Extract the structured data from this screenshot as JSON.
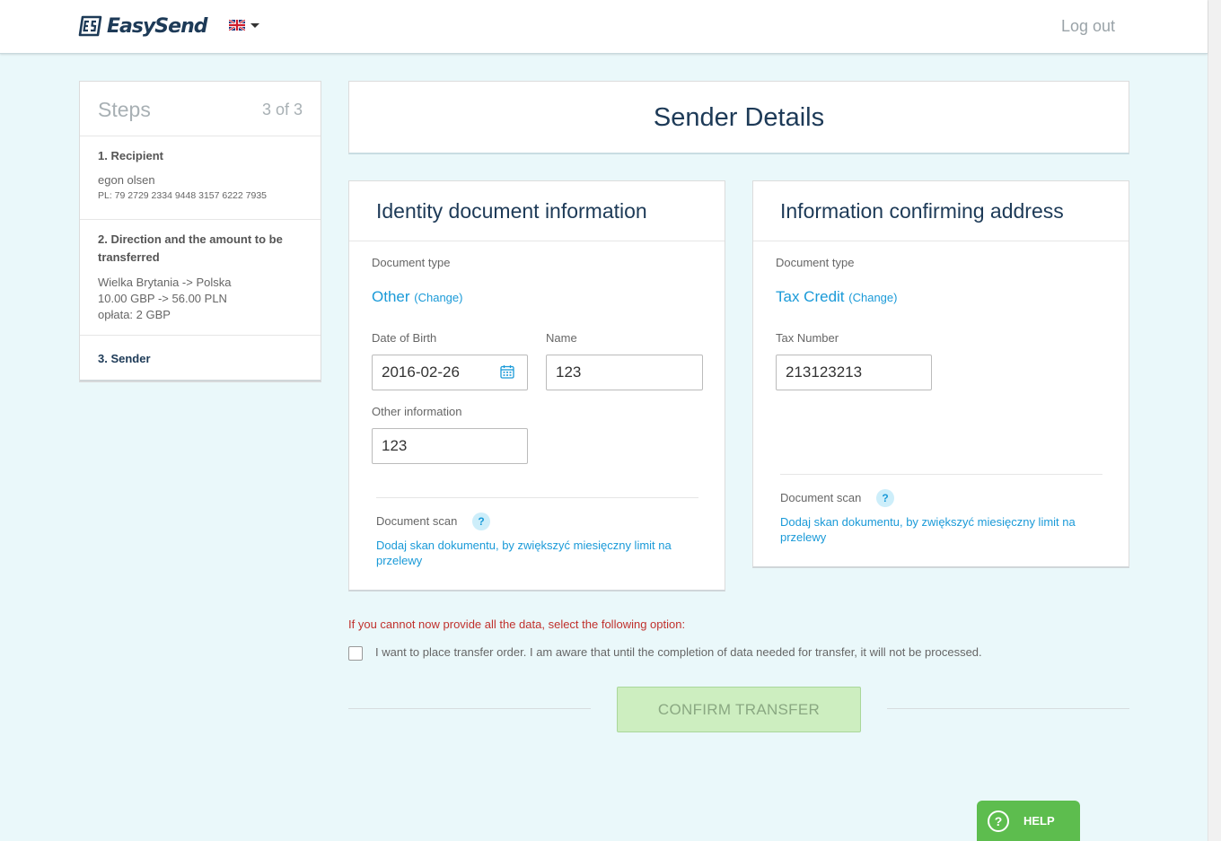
{
  "header": {
    "brand": "EasySend",
    "logout_label": "Log out"
  },
  "steps": {
    "title": "Steps",
    "count": "3 of 3",
    "step1": {
      "title": "1. Recipient",
      "name": "egon olsen",
      "account": "PL: 79 2729 2334 9448 3157 6222 7935"
    },
    "step2": {
      "title_line1": "2. Direction and the amount to be",
      "title_line2": "transferred",
      "direction": "Wielka Brytania -> Polska",
      "amount": "10.00 GBP -> 56.00 PLN",
      "fee": "opłata: 2 GBP"
    },
    "step3": {
      "title": "3. Sender"
    }
  },
  "main": {
    "title": "Sender Details"
  },
  "identity": {
    "title": "Identity document information",
    "doc_type_label": "Document type",
    "doc_type_value": "Other",
    "change_label": "(Change)",
    "dob_label": "Date of Birth",
    "dob_value": "2016-02-26",
    "name_label": "Name",
    "name_value": "123",
    "other_label": "Other information",
    "other_value": "123",
    "scan_label": "Document scan",
    "scan_help": "?",
    "scan_link_line1": "Dodaj skan dokumentu, by zwiększyć miesięczny limit na",
    "scan_link_line2": "przelewy"
  },
  "address": {
    "title": "Information confirming address",
    "doc_type_label": "Document type",
    "doc_type_value": "Tax Credit",
    "change_label": "(Change)",
    "tax_label": "Tax Number",
    "tax_value": "213123213",
    "scan_label": "Document scan",
    "scan_help": "?",
    "scan_link_line1": "Dodaj skan dokumentu, by zwiększyć miesięczny limit na",
    "scan_link_line2": "przelewy"
  },
  "footer": {
    "warning": "If you cannot now provide all the data, select the following option:",
    "checkbox_label": "I want to place transfer order. I am aware that until the completion of data needed for transfer, it will not be processed.",
    "confirm_label": "CONFIRM TRANSFER",
    "help_label": "HELP",
    "help_icon": "?"
  },
  "colors": {
    "background": "#eaf8fa",
    "navy": "#1d3a57",
    "link_blue": "#1a9ad8",
    "warning_red": "#c0312d",
    "confirm_green": "#cdeec0",
    "help_green": "#5dbd4e"
  }
}
